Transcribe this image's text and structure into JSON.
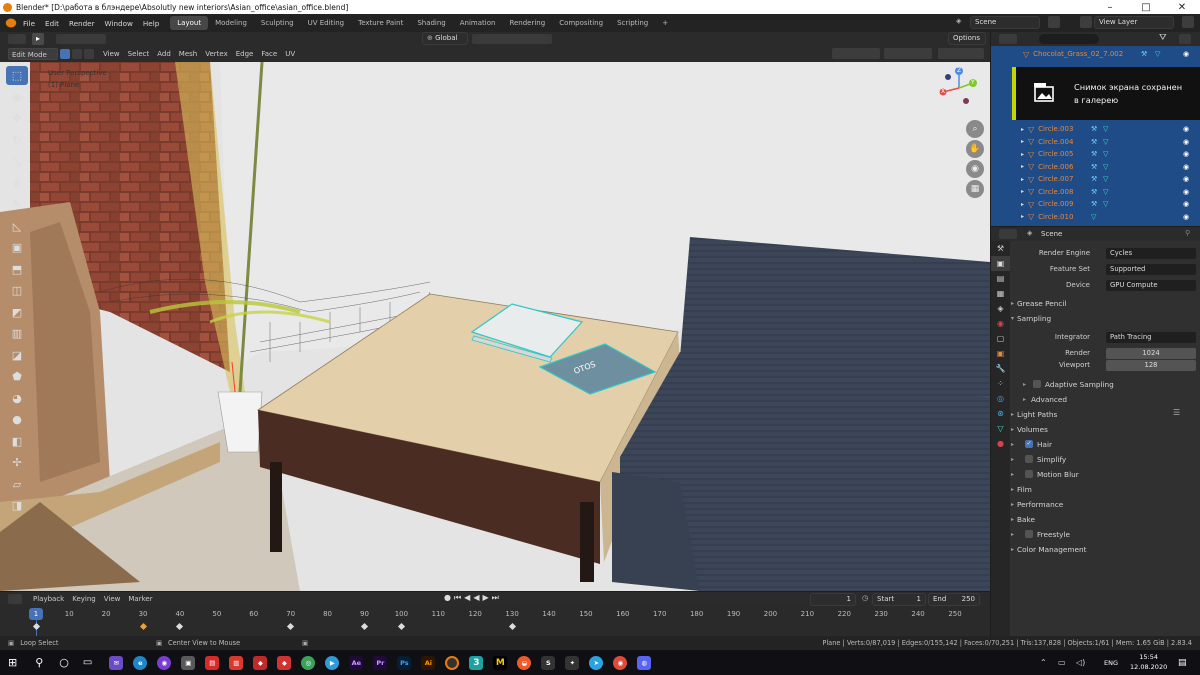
{
  "window": {
    "title": "Blender* [D:\\работа в блэндере\\Absolutly new interiors\\Asian_office\\asian_office.blend]",
    "min": "–",
    "max": "□",
    "close": "✕"
  },
  "menu": [
    "File",
    "Edit",
    "Render",
    "Window",
    "Help"
  ],
  "workspaces": [
    "Layout",
    "Modeling",
    "Sculpting",
    "UV Editing",
    "Texture Paint",
    "Shading",
    "Animation",
    "Rendering",
    "Compositing",
    "Scripting",
    "+"
  ],
  "scene": {
    "name": "Scene",
    "view_layer": "View Layer"
  },
  "viewport": {
    "mode": "Edit Mode",
    "menus": [
      "View",
      "Select",
      "Add",
      "Mesh",
      "Vertex",
      "Edge",
      "Face",
      "UV"
    ],
    "orientation": "Global",
    "options": "Options",
    "perspective": "User Perspective",
    "object": "(1) Plane",
    "gizmo": {
      "z": "Z",
      "y": "Y",
      "x": "X"
    },
    "book_title": "OTOS"
  },
  "toolbar_icons": [
    "select-box-icon",
    "cursor-icon",
    "move-icon",
    "rotate-icon",
    "scale-icon",
    "transform-icon",
    "annotate-icon",
    "measure-icon",
    "add-cube-icon",
    "extrude-icon",
    "inset-icon",
    "bevel-icon",
    "loop-cut-icon",
    "knife-icon",
    "poly-build-icon",
    "spin-icon",
    "smooth-icon",
    "edge-slide-icon",
    "shrink-fatten-icon",
    "shear-icon",
    "rip-icon"
  ],
  "outliner": {
    "rows": [
      "Chocolat_Grass_02_7.002",
      "",
      "",
      "",
      "",
      "",
      "",
      "Circle.003",
      "Circle.004",
      "Circle.005",
      "Circle.006",
      "Circle.007",
      "Circle.008",
      "Circle.009",
      "Circle.010"
    ]
  },
  "toast": {
    "line1": "Снимок экрана сохранен",
    "line2": "в галерею"
  },
  "properties": {
    "context": "Scene",
    "render_engine_label": "Render Engine",
    "render_engine": "Cycles",
    "feature_set_label": "Feature Set",
    "feature_set": "Supported",
    "device_label": "Device",
    "device": "GPU Compute",
    "panels": {
      "grease_pencil": "Grease Pencil",
      "sampling": "Sampling",
      "integrator_label": "Integrator",
      "integrator": "Path Tracing",
      "render_label": "Render",
      "render": "1024",
      "viewport_label": "Viewport",
      "viewport": "128",
      "adaptive": "Adaptive Sampling",
      "advanced": "Advanced",
      "light_paths": "Light Paths",
      "volumes": "Volumes",
      "hair": "Hair",
      "simplify": "Simplify",
      "motion_blur": "Motion Blur",
      "film": "Film",
      "performance": "Performance",
      "bake": "Bake",
      "freestyle": "Freestyle",
      "color_management": "Color Management"
    }
  },
  "timeline": {
    "menus": [
      "Playback",
      "Keying",
      "View",
      "Marker"
    ],
    "current": "1",
    "start_label": "Start",
    "start": "1",
    "end_label": "End",
    "end": "250",
    "frames": [
      "1",
      "10",
      "20",
      "30",
      "40",
      "50",
      "60",
      "70",
      "80",
      "90",
      "100",
      "110",
      "120",
      "130",
      "140",
      "150",
      "160",
      "170",
      "180",
      "190",
      "200",
      "210",
      "220",
      "230",
      "240",
      "250"
    ],
    "keyframes": [
      1,
      30,
      40,
      70,
      90,
      100,
      130
    ]
  },
  "status": {
    "left": "Loop Select",
    "middle": "Center View to Mouse",
    "right": "Plane | Verts:0/87,019 | Edges:0/155,142 | Faces:0/70,251 | Tris:137,828 | Objects:1/61 | Mem: 1.65 GiB | 2.83.4"
  },
  "taskbar": {
    "apps": [
      "Ae",
      "Pr",
      "Ps",
      "Ai"
    ],
    "lang": "ENG",
    "time": "15:54",
    "date": "12.08.2020"
  },
  "colors": {
    "accent": "#4772b3",
    "outliner_bg": "#1f4b86",
    "toast_bar": "#c4d600",
    "orange": "#e8883a"
  }
}
